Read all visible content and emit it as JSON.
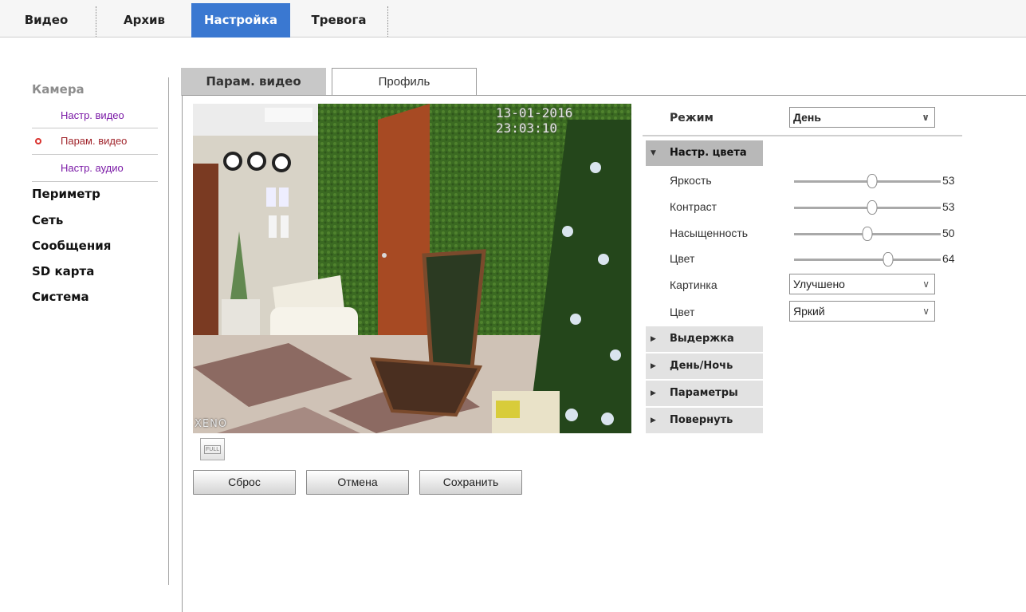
{
  "topnav": {
    "tabs": [
      {
        "label": "Видео",
        "active": false
      },
      {
        "label": "Архив",
        "active": false
      },
      {
        "label": "Настройка",
        "active": true
      },
      {
        "label": "Тревога",
        "active": false
      }
    ]
  },
  "sidebar": {
    "group_title": "Камера",
    "subitems": [
      {
        "label": "Настр. видео",
        "active": false
      },
      {
        "label": "Парам. видео",
        "active": true
      },
      {
        "label": "Настр. аудио",
        "active": false
      }
    ],
    "items": [
      "Периметр",
      "Сеть",
      "Сообщения",
      "SD карта",
      "Система"
    ]
  },
  "page_tabs": {
    "active": "Парам. видео",
    "inactive": "Профиль"
  },
  "video": {
    "timestamp": "13-01-2016 23:03:10",
    "brand_watermark": "XENO",
    "full_button": "FULL"
  },
  "buttons": {
    "reset": "Сброс",
    "cancel": "Отмена",
    "save": "Сохранить"
  },
  "settings": {
    "mode_label": "Режим",
    "mode_value": "День",
    "color_section": "Настр. цвета",
    "sliders": [
      {
        "label": "Яркость",
        "value": 53
      },
      {
        "label": "Контраст",
        "value": 53
      },
      {
        "label": "Насыщенность",
        "value": 50
      },
      {
        "label": "Цвет",
        "value": 64
      }
    ],
    "picture_label": "Картинка",
    "picture_value": "Улучшено",
    "color_label": "Цвет",
    "color_value": "Яркий",
    "sections": [
      "Выдержка",
      "День/Ночь",
      "Параметры",
      "Повернуть"
    ]
  },
  "colors": {
    "accent": "#3a78d1",
    "submenu_link": "#7a19a6",
    "active_marker": "#d9322e"
  }
}
